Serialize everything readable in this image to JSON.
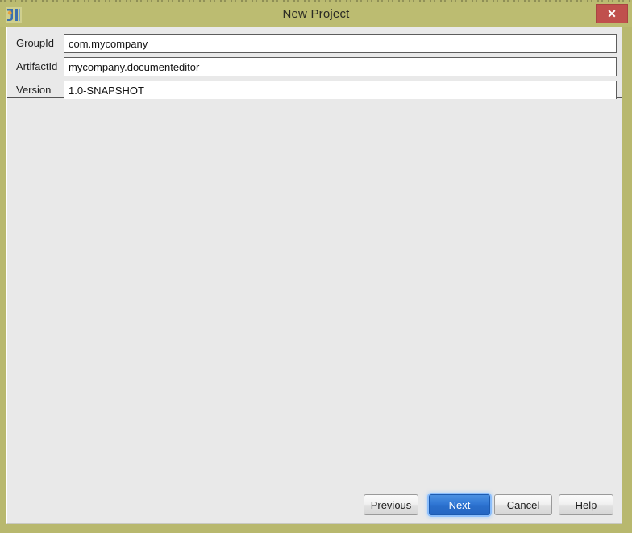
{
  "window": {
    "title": "New Project",
    "icon": "intellij-idea-icon",
    "close_label": "✕",
    "titlebar_color": "#bcbc71",
    "frame_color": "#b8b86e",
    "body_color": "#e9e9e9"
  },
  "form": {
    "fields": [
      {
        "label": "GroupId",
        "value": "com.mycompany",
        "placeholder": "GroupId",
        "name": "groupid"
      },
      {
        "label": "ArtifactId",
        "value": "mycompany.documenteditor",
        "placeholder": "ArtifactId",
        "name": "artifactid"
      },
      {
        "label": "Version",
        "value": "1.0-SNAPSHOT",
        "placeholder": "Version",
        "name": "version"
      }
    ]
  },
  "buttons": {
    "previous": {
      "prefix": "",
      "mnemonic": "P",
      "suffix": "revious",
      "default": false
    },
    "next": {
      "prefix": "",
      "mnemonic": "N",
      "suffix": "ext",
      "default": true
    },
    "cancel": {
      "label": "Cancel",
      "default": false
    },
    "help": {
      "label": "Help",
      "default": false
    }
  },
  "colors": {
    "accent_blue": "#2f76d4",
    "close_red": "#c0504d",
    "olive": "#b8b86e"
  }
}
